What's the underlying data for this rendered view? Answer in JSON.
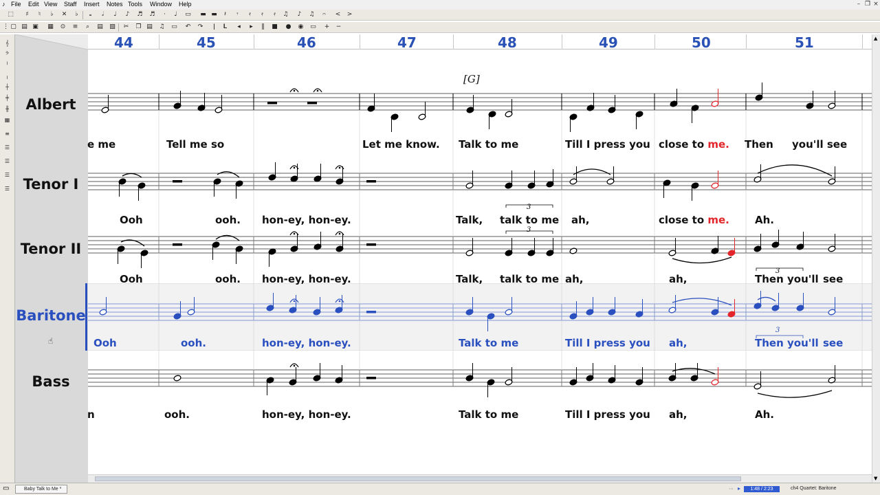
{
  "menu": [
    "File",
    "Edit",
    "View",
    "Staff",
    "Insert",
    "Notes",
    "Tools",
    "Window",
    "Help"
  ],
  "measures": [
    "44",
    "45",
    "46",
    "47",
    "48",
    "49",
    "50",
    "51"
  ],
  "staves": [
    {
      "name": "Albert",
      "selected": false
    },
    {
      "name": "Tenor I",
      "selected": false
    },
    {
      "name": "Tenor II",
      "selected": false
    },
    {
      "name": "Baritone",
      "selected": true
    },
    {
      "name": "Bass",
      "selected": false
    }
  ],
  "rehearsal_mark": "[G]",
  "lyrics": {
    "albert": [
      "e me",
      "Tell me so",
      "Let me know.",
      "Talk to me",
      "Till I press you",
      "close to",
      "me.",
      "Then",
      "you'll see"
    ],
    "tenor1": [
      "Ooh",
      "ooh.",
      "hon-ey, hon-ey.",
      "Talk,",
      "talk to me",
      "ah,",
      "close to",
      "me.",
      "Ah."
    ],
    "tenor2": [
      "Ooh",
      "ooh.",
      "hon-ey, hon-ey.",
      "Talk,",
      "talk to me",
      "ah,",
      "ah,",
      "Then you'll",
      "see"
    ],
    "baritone": [
      "Ooh",
      "ooh.",
      "hon-ey, hon-ey.",
      "Talk to me",
      "Till I press you",
      "ah,",
      "Then you'll",
      "see"
    ],
    "bass": [
      "n",
      "ooh.",
      "hon-ey, hon-ey.",
      "Talk to me",
      "Till I press you",
      "ah,",
      "Ah."
    ]
  },
  "tuplet_label": "3",
  "taskbar": {
    "document": "Baby Talk to Me *",
    "time": "1:48 / 2:23",
    "status": "ch4 Quartet: Baritone"
  },
  "colors": {
    "measure_numbers": "#2a52b6",
    "selected_staff": "#2a4fbf",
    "highlight_note": "#e3262b"
  }
}
